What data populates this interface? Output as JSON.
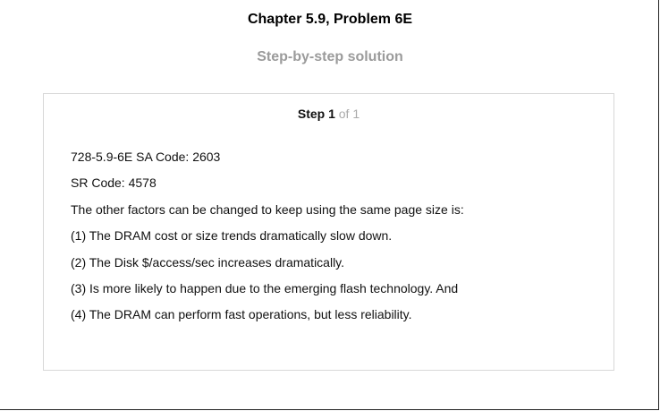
{
  "header": {
    "chapter_title": "Chapter 5.9, Problem 6E",
    "subtitle": "Step-by-step solution"
  },
  "step": {
    "label": "Step 1",
    "total": "of 1",
    "lines": [
      "728-5.9-6E SA Code: 2603",
      "SR Code: 4578",
      "The other factors can be changed to keep using the same page size is:",
      "(1) The DRAM cost or size trends dramatically slow down.",
      "(2) The Disk $/access/sec increases dramatically.",
      "(3) Is more likely to happen due to the emerging flash technology. And",
      "(4) The DRAM can perform fast operations, but less reliability."
    ]
  },
  "colors": {
    "subtitle": "#9b9b9b",
    "box_border": "#d8d8d8",
    "step_total": "#aaaaaa"
  }
}
